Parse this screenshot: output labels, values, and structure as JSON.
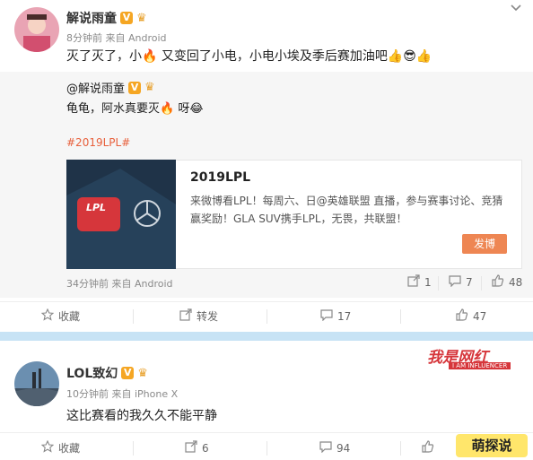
{
  "post1": {
    "author": "解说雨童",
    "meta": "8分钟前 来自 Android",
    "text": "灭了灭了，小🔥 又变回了小电，小电小埃及季后赛加油吧👍😎👍",
    "repost": {
      "author": "@解说雨童",
      "text": "龟龟，阿水真要灭🔥 呀😂",
      "topic": "#2019LPL#",
      "card": {
        "title": "2019LPL",
        "desc": "来微博看LPL！每周六、日@英雄联盟 直播，参与赛事讨论、竞猜赢奖励！GLA SUV携手LPL，无畏，共联盟！",
        "button": "发博",
        "logo": "LPL"
      },
      "meta": "34分钟前 来自 Android",
      "stats": {
        "repost": "1",
        "comment": "7",
        "like": "48"
      }
    },
    "actions": {
      "collect": "收藏",
      "repost": "转发",
      "comment": "17",
      "like": "47"
    }
  },
  "post2": {
    "author": "LOL致幻",
    "meta": "10分钟前 来自 iPhone X",
    "text": "这比赛看的我久久不能平静",
    "actions": {
      "collect": "收藏",
      "repost": "6",
      "comment": "94",
      "like": ""
    }
  },
  "watermarks": {
    "top_right": "",
    "mid_right": "我是网红",
    "mid_right_sub": "I AM INFLUENCER",
    "bottom_right": "萌探说"
  },
  "colors": {
    "accent": "#ee8653",
    "topic": "#e8603c",
    "lpl_red": "#d6363b",
    "badge": "#f5a623"
  }
}
